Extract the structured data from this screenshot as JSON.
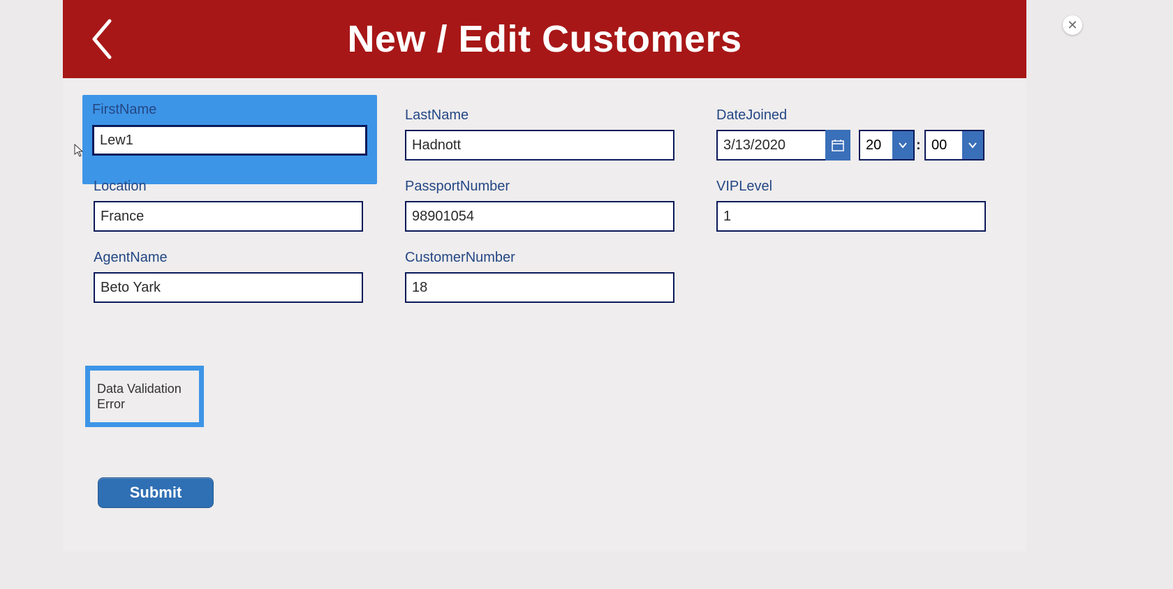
{
  "header": {
    "title": "New / Edit Customers"
  },
  "form": {
    "firstName": {
      "label": "FirstName",
      "value": "Lew1"
    },
    "lastName": {
      "label": "LastName",
      "value": "Hadnott"
    },
    "dateJoined": {
      "label": "DateJoined",
      "date": "3/13/2020",
      "hour": "20",
      "minute": "00",
      "separator": ":"
    },
    "location": {
      "label": "Location",
      "value": "France"
    },
    "passport": {
      "label": "PassportNumber",
      "value": "98901054"
    },
    "vipLevel": {
      "label": "VIPLevel",
      "value": "1"
    },
    "agentName": {
      "label": "AgentName",
      "value": "Beto Yark"
    },
    "custNumber": {
      "label": "CustomerNumber",
      "value": "18"
    }
  },
  "error": {
    "message": "Data Validation Error"
  },
  "actions": {
    "submit": "Submit"
  },
  "colors": {
    "headerBg": "#a81717",
    "highlight": "#3d95e7",
    "inputBorder": "#0b1a5a",
    "label": "#244785",
    "buttonBg": "#2f6fb3"
  }
}
